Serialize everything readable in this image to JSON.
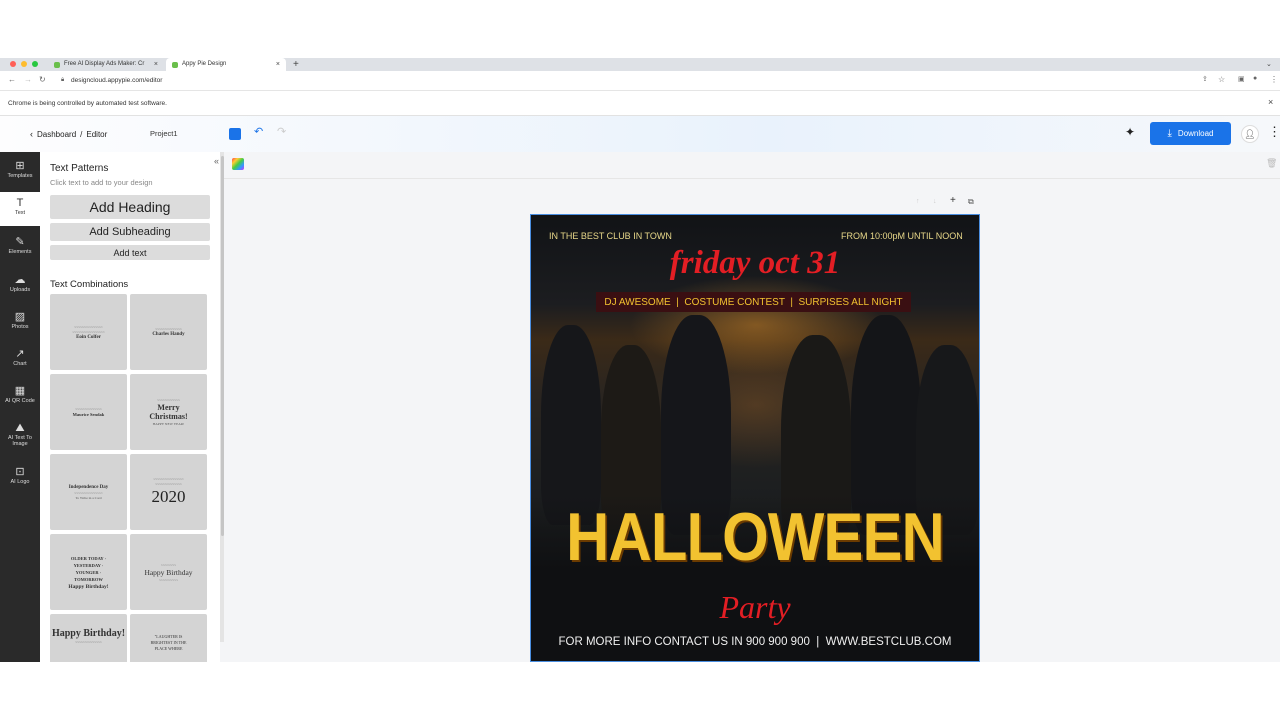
{
  "browser": {
    "tabs": [
      {
        "label": "Free AI Display Ads Maker: Cr",
        "active": false
      },
      {
        "label": "Appy Pie Design",
        "active": true
      }
    ],
    "url": "designcloud.appypie.com/editor",
    "automation_notice": "Chrome is being controlled by automated test software."
  },
  "header": {
    "breadcrumb_dashboard": "Dashboard",
    "breadcrumb_sep": "/",
    "breadcrumb_editor": "Editor",
    "project_name": "Project1",
    "download_label": "Download"
  },
  "rail": {
    "items": [
      {
        "label": "Templates",
        "icon": "templates-icon"
      },
      {
        "label": "Text",
        "icon": "text-icon"
      },
      {
        "label": "Elements",
        "icon": "elements-icon"
      },
      {
        "label": "Uploads",
        "icon": "uploads-icon"
      },
      {
        "label": "Photos",
        "icon": "photos-icon"
      },
      {
        "label": "Chart",
        "icon": "chart-icon"
      },
      {
        "label": "AI QR Code",
        "icon": "qr-code-icon"
      },
      {
        "label": "AI Text To Image",
        "icon": "ai-image-icon"
      },
      {
        "label": "AI Logo",
        "icon": "ai-logo-icon"
      }
    ],
    "active": "Text"
  },
  "panel": {
    "title": "Text Patterns",
    "subtitle": "Click text to add to your design",
    "add_heading": "Add Heading",
    "add_subheading": "Add Subheading",
    "add_text": "Add text",
    "combinations_title": "Text Combinations",
    "cards": [
      {
        "main": "Eoin Colfer"
      },
      {
        "main": "Charles Handy"
      },
      {
        "main": "Maurice Sendak"
      },
      {
        "main": "Merry Christmas!",
        "sub": "HAPPY NEW YEAR!"
      },
      {
        "main": "Independence Day",
        "sub": "To Write in a Card"
      },
      {
        "main": "2020"
      },
      {
        "main": "OLDER TODAY · YESTERDAY · YOUNGER · TOMORROW",
        "sub": "Happy Birthday!"
      },
      {
        "main": "Happy Birthday"
      },
      {
        "main": "Happy Birthday!"
      },
      {
        "main": "\"LAUGHTER IS BRIGHTEST IN THE PLACE WHERE"
      }
    ]
  },
  "flyer": {
    "top_left": "IN THE BEST CLUB IN TOWN",
    "top_right": "FROM 10:00pM UNTIL NOON",
    "date_script": "friday oct 31",
    "lineup": "DJ AWESOME  |  COSTUME CONTEST  |  SURPISES ALL NIGHT",
    "title": "HALLOWEEN",
    "subtitle_script": "Party",
    "footer": "FOR MORE INFO CONTACT US IN 900 900 900  |  WWW.BESTCLUB.COM",
    "colors": {
      "red": "#e31e24",
      "gold": "#f2c230",
      "yellow_text": "#e9d98a"
    }
  },
  "colors": {
    "accent": "#1a73e8",
    "rail": "#2a2a2a"
  }
}
